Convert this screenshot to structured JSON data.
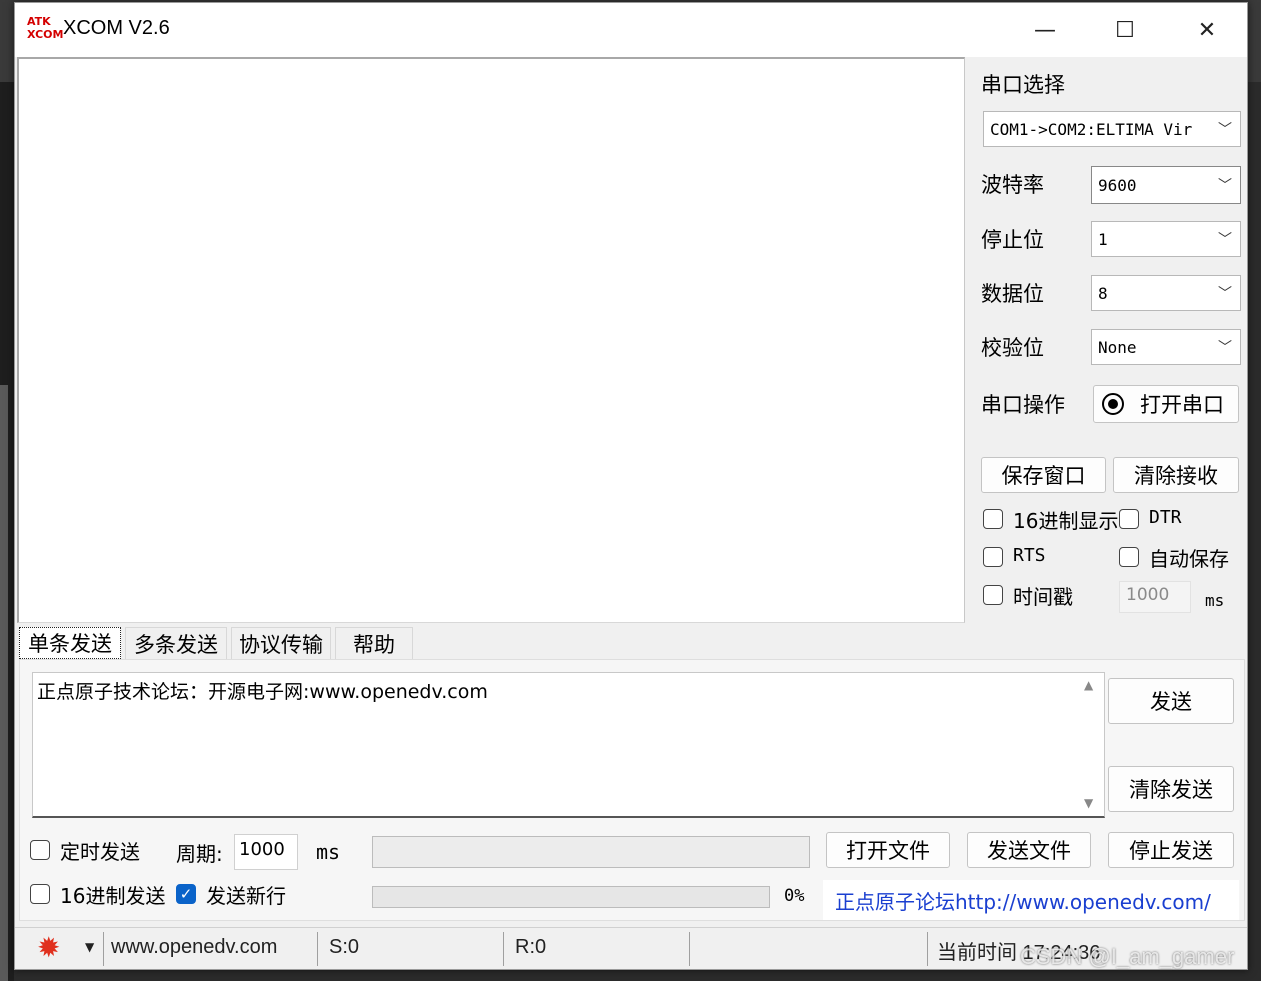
{
  "window": {
    "logo_top": "ATK",
    "logo_bottom": "XCOM",
    "title": "XCOM V2.6",
    "minimize": "—",
    "maximize": "☐",
    "close": "✕"
  },
  "port": {
    "section_label": "串口选择",
    "port_value": "COM1->COM2:ELTIMA Vir",
    "baud_label": "波特率",
    "baud_value": "9600",
    "stop_label": "停止位",
    "stop_value": "1",
    "data_label": "数据位",
    "data_value": "8",
    "parity_label": "校验位",
    "parity_value": "None",
    "op_label": "串口操作",
    "open_button": "打开串口"
  },
  "recv": {
    "save_button": "保存窗口",
    "clear_button": "清除接收",
    "hex_display": "16进制显示",
    "dtr": "DTR",
    "rts": "RTS",
    "auto_save": "自动保存",
    "timestamp": "时间戳",
    "timestamp_value": "1000",
    "ms": "ms"
  },
  "tabs": [
    "单条发送",
    "多条发送",
    "协议传输",
    "帮助"
  ],
  "send": {
    "text": "正点原子技术论坛：开源电子网:www.openedv.com",
    "send_button": "发送",
    "clear_send_button": "清除发送",
    "timed_send": "定时发送",
    "period_label": "周期:",
    "period_value": "1000",
    "ms": "ms",
    "open_file": "打开文件",
    "send_file": "发送文件",
    "stop_send": "停止发送",
    "hex_send": "16进制发送",
    "newline": "发送新行",
    "progress_pct": "0%",
    "link": "正点原子论坛http://www.openedv.com/"
  },
  "status": {
    "url": "www.openedv.com",
    "sent": "S:0",
    "received": "R:0",
    "time": "当前时间 17:24:36"
  },
  "watermark": "CSDN @I_am_gamer",
  "colors": {
    "accent": "#0a63c9",
    "logo": "#d40000",
    "link": "#1a3fd0",
    "gear": "#e0301e"
  }
}
